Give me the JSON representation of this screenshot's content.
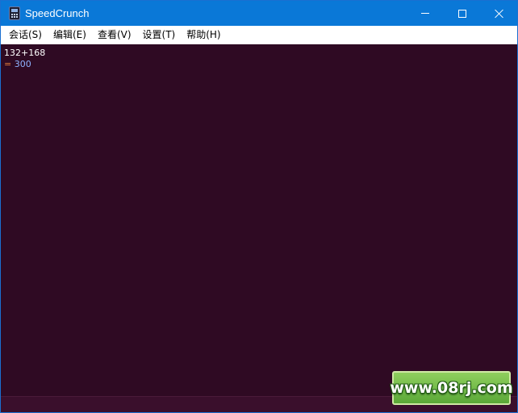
{
  "window": {
    "title": "SpeedCrunch",
    "controls": {
      "minimize": "minimize",
      "maximize": "maximize",
      "close": "close"
    }
  },
  "menu": {
    "items": [
      {
        "label": "会话(S)"
      },
      {
        "label": "编辑(E)"
      },
      {
        "label": "查看(V)"
      },
      {
        "label": "设置(T)"
      },
      {
        "label": "帮助(H)"
      }
    ]
  },
  "console": {
    "expression": "132+168",
    "result_prefix": "=",
    "result_value": "300"
  },
  "watermark": {
    "text": "www.08rj.com"
  },
  "colors": {
    "titlebar": "#0a78d7",
    "console_bg": "#2f0a23",
    "result_eq": "#e07a3a",
    "result_value": "#8fb3ff"
  }
}
